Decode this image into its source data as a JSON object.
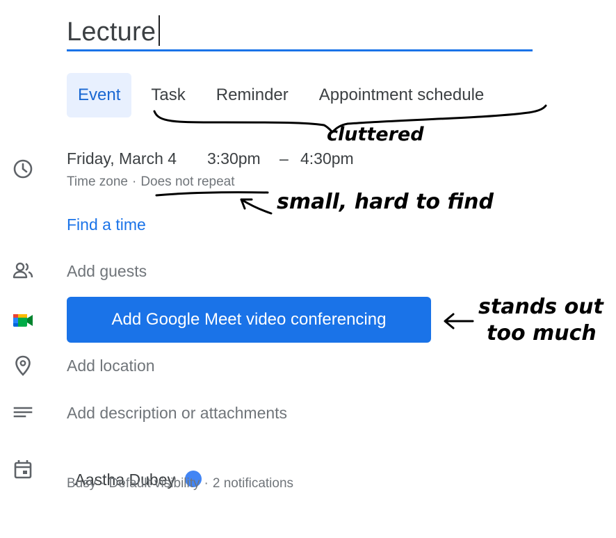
{
  "title_input": {
    "value": "Lecture"
  },
  "tabs": [
    {
      "label": "Event",
      "active": true
    },
    {
      "label": "Task",
      "active": false
    },
    {
      "label": "Reminder",
      "active": false
    },
    {
      "label": "Appointment schedule",
      "active": false
    }
  ],
  "datetime": {
    "date": "Friday, March 4",
    "start": "3:30pm",
    "separator": "–",
    "end": "4:30pm",
    "timezone_label": "Time zone",
    "repeat_label": "Does not repeat"
  },
  "find_time_link": "Find a time",
  "guests_placeholder": "Add guests",
  "meet_button_label": "Add Google Meet video conferencing",
  "location_placeholder": "Add location",
  "description_placeholder": "Add description or attachments",
  "calendar": {
    "owner": "Aastha Dubey",
    "color": "#4285f4",
    "busy": "Busy",
    "visibility": "Default visibility",
    "notifications": "2 notifications"
  },
  "annotations": {
    "cluttered": "cluttered",
    "small_hard": "small, hard to find",
    "stands_out_1": "stands out",
    "stands_out_2": "too much"
  },
  "colors": {
    "accent": "#1a73e8",
    "active_tab_bg": "#e8f0fe",
    "text": "#3c4043",
    "muted": "#70757a"
  },
  "icons": {
    "clock": "clock-icon",
    "guests": "people-icon",
    "meet": "google-meet-icon",
    "location": "location-pin-icon",
    "description": "notes-icon",
    "calendar": "calendar-icon"
  }
}
